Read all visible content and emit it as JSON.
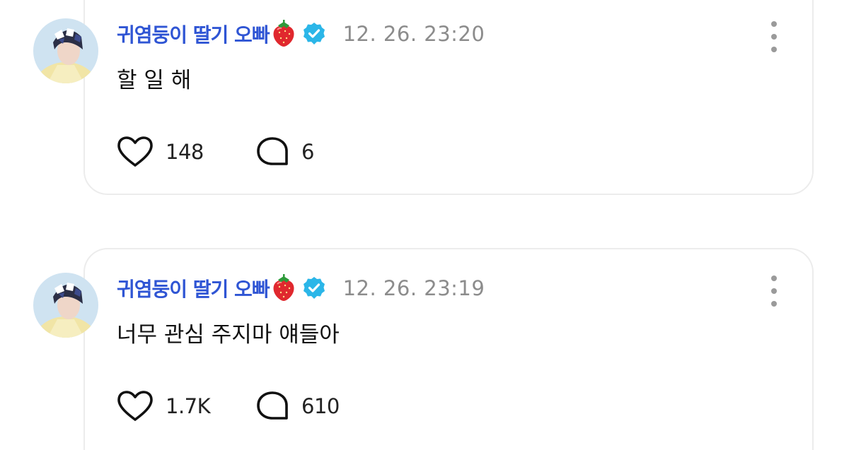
{
  "posts": [
    {
      "author": "귀염둥이 딸기 오빠",
      "timestamp": "12. 26. 23:20",
      "text": "할 일 해",
      "likes": "148",
      "comments": "6",
      "verified": true,
      "emoji": "strawberry"
    },
    {
      "author": "귀염둥이 딸기 오빠",
      "timestamp": "12. 26. 23:19",
      "text": "너무 관심 주지마 얘들아",
      "likes": "1.7K",
      "comments": "610",
      "verified": true,
      "emoji": "strawberry"
    }
  ],
  "colors": {
    "author": "#2f55d4",
    "verified_badge": "#2bb6e8",
    "timestamp": "#8c8c8c",
    "card_border": "#ececec"
  },
  "icons": {
    "like": "heart-outline-icon",
    "comment": "speech-bubble-icon",
    "more": "vertical-ellipsis-icon",
    "verified": "verified-badge-icon"
  }
}
